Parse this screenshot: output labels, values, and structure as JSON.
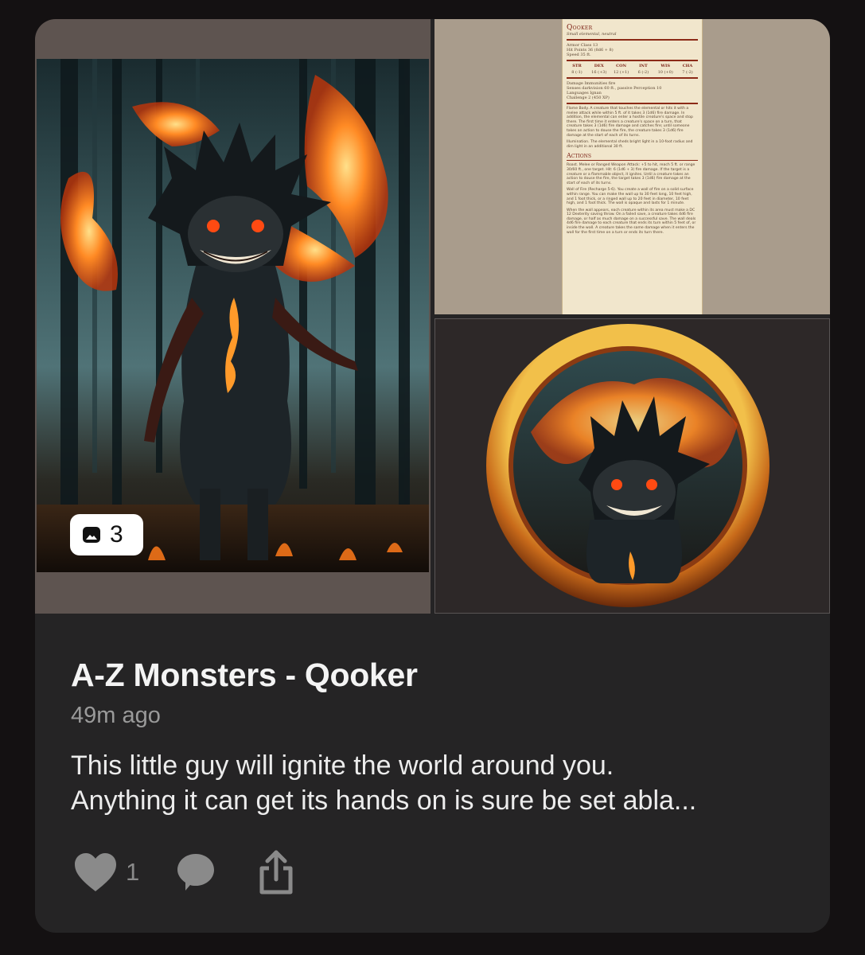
{
  "post": {
    "title": "A-Z Monsters - Qooker",
    "time": "49m ago",
    "description": "This little guy will ignite the world around you.\nAnything it can get its hands on is sure be set abla...",
    "image_count": "3",
    "like_count": "1"
  },
  "statblock": {
    "name": "Qooker",
    "type": "Small elemental, neutral",
    "armor_class": "Armor Class 13",
    "hit_points": "Hit Points 36 (8d6 + 8)",
    "speed": "Speed 35 ft.",
    "abilities": [
      {
        "name": "STR",
        "value": "8 (-1)"
      },
      {
        "name": "DEX",
        "value": "16 (+3)"
      },
      {
        "name": "CON",
        "value": "12 (+1)"
      },
      {
        "name": "INT",
        "value": "6 (-2)"
      },
      {
        "name": "WIS",
        "value": "10 (+0)"
      },
      {
        "name": "CHA",
        "value": "7 (-2)"
      }
    ],
    "damage_immunities": "Damage Immunities fire",
    "senses": "Senses darkvision 60 ft., passive Perception 10",
    "languages": "Languages Ignan",
    "challenge": "Challenge 2 (450 XP)",
    "flame_body": "Flame Body. A creature that touches the elemental or hits it with a melee attack while within 5 ft. of it takes 3 (1d6) fire damage. In addition, the elemental can enter a hostile creature's space and stop there. The first time it enters a creature's space on a turn, that creature takes 3 (1d6) fire damage and catches fire; until someone takes an action to douse the fire, the creature takes 3 (1d6) fire damage at the start of each of its turns.",
    "illumination": "Illumination. The elemental sheds bright light in a 10-foot radius and dim light in an additional 30 ft.",
    "actions_heading": "Actions",
    "roast": "Roast. Melee or Ranged Weapon Attack: +5 to hit, reach 5 ft. or range 30/60 ft., one target. Hit: 6 (1d6 + 3) fire damage. If the target is a creature or a flammable object, it ignites. Until a creature takes an action to douse the fire, the target takes 3 (1d6) fire damage at the start of each of its turns.",
    "wall_of_fire": "Wall of Fire (Recharge 5-6). You create a wall of fire on a solid surface within range. You can make the wall up to 30 feet long, 10 feet high, and 1 foot thick, or a ringed wall up to 20 feet in diameter, 10 feet high, and 1 foot thick. The wall is opaque and lasts for 1 minute.",
    "wall_extra": "When the wall appears, each creature within its area must make a DC 12 Dexterity saving throw. On a failed save, a creature takes 4d6 fire damage, or half as much damage on a successful save. The wall deals 4d6 fire damage to each creature that ends its turn within 5 feet of, or inside the wall. A creature takes the same damage when it enters the wall for the first time on a turn or ends its turn there."
  },
  "icons": {
    "gallery": "image-stack-icon",
    "like": "heart-icon",
    "comment": "comment-icon",
    "share": "share-icon"
  },
  "colors": {
    "background": "#141112",
    "card": "#252425",
    "title": "#f4f4f4",
    "muted": "#9a9a9a",
    "icon": "#8a8a8a"
  }
}
